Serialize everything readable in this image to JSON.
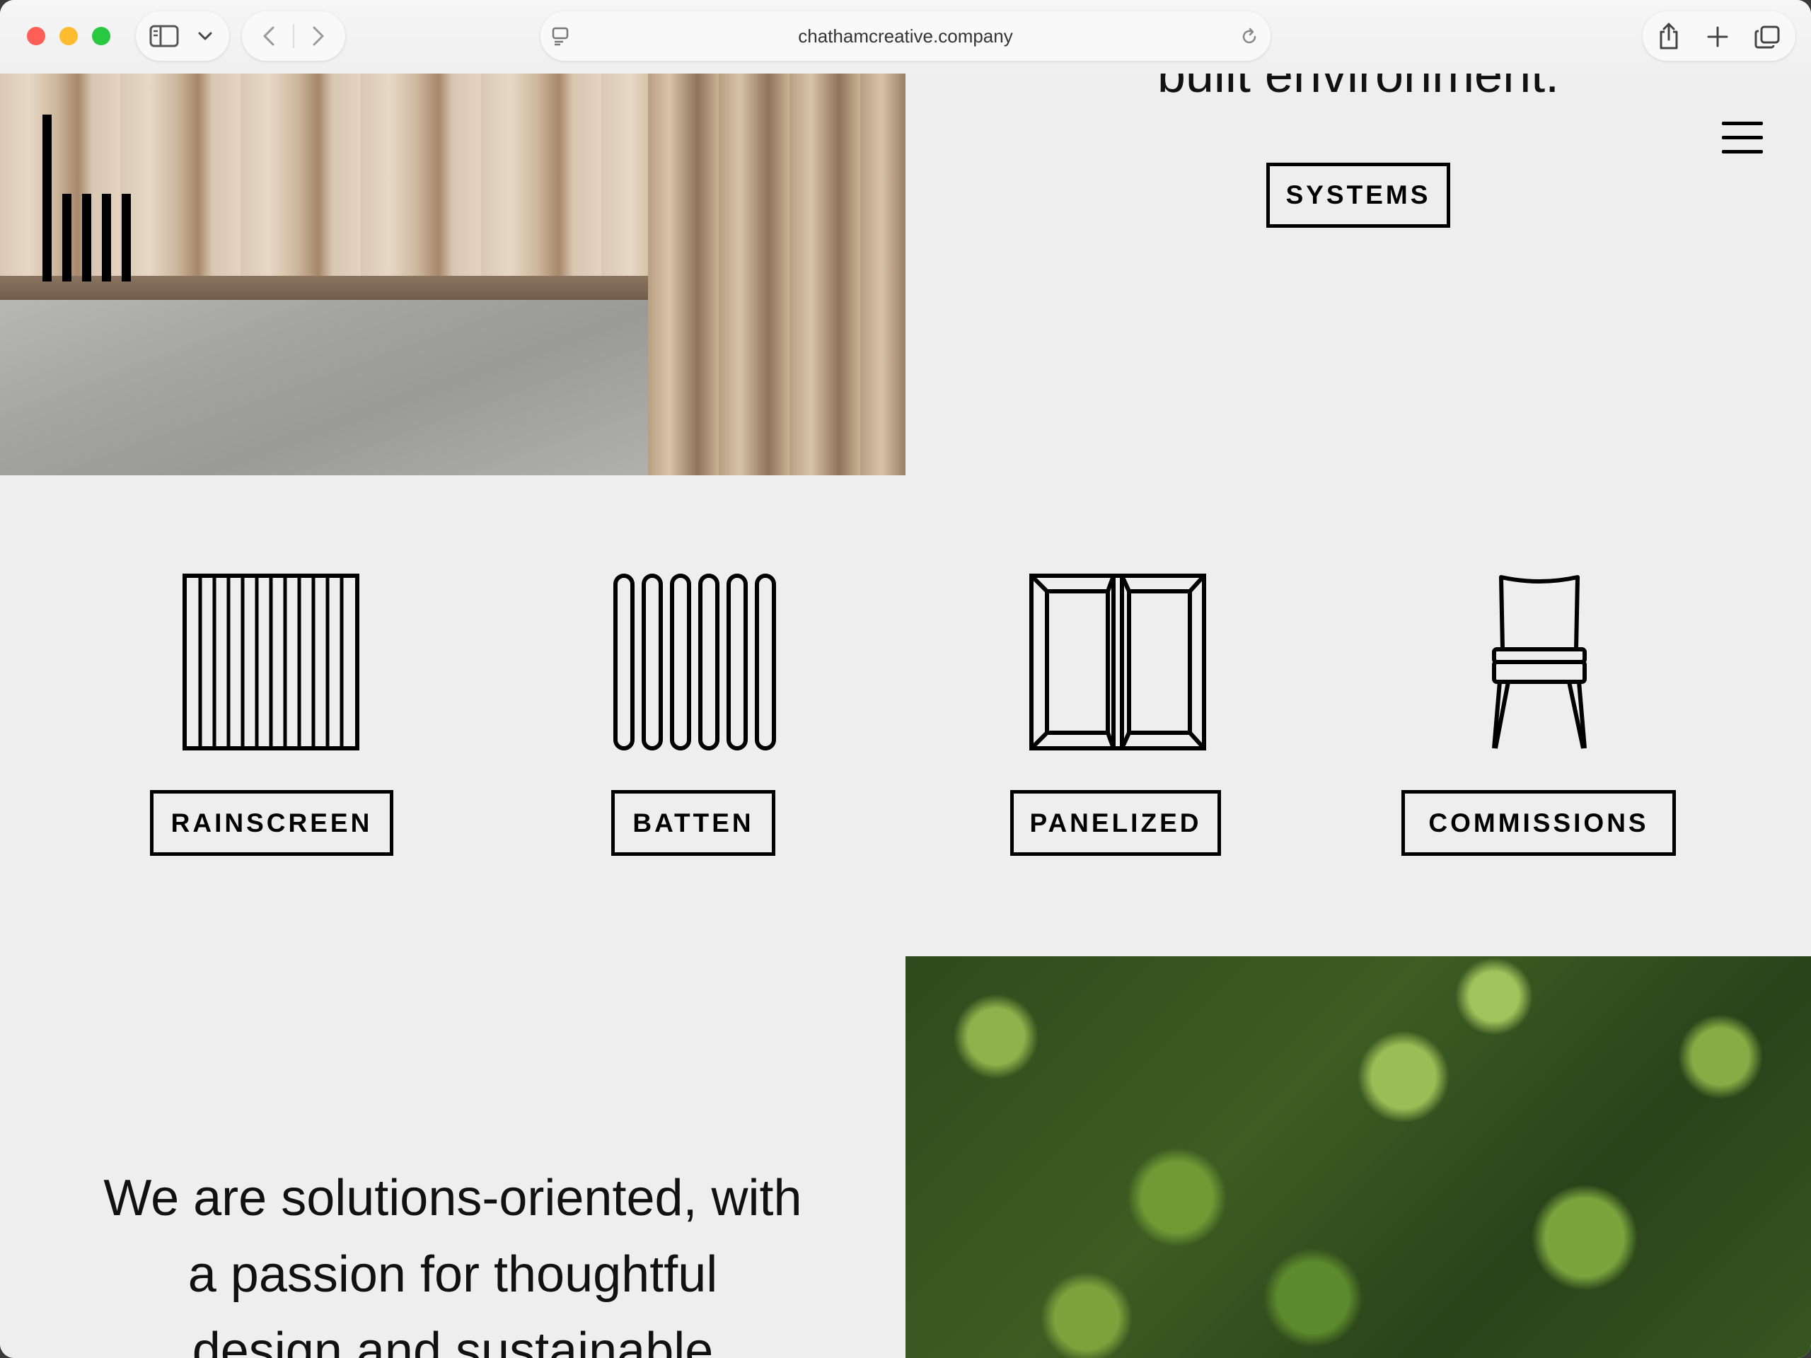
{
  "browser": {
    "url": "chathamcreative.company"
  },
  "hero": {
    "headline": "built environment.",
    "systems_label": "SYSTEMS"
  },
  "systems": [
    {
      "label": "RAINSCREEN",
      "icon": "rainscreen-icon"
    },
    {
      "label": "BATTEN",
      "icon": "batten-icon"
    },
    {
      "label": "PANELIZED",
      "icon": "panelized-icon"
    },
    {
      "label": "COMMISSIONS",
      "icon": "chair-icon"
    }
  ],
  "about": {
    "line1": "We are solutions-oriented, with",
    "line2": "a passion for thoughtful",
    "line3": "design and sustainable"
  },
  "colors": {
    "background": "#eeeeee",
    "text": "#000000",
    "close": "#ff5f57",
    "minimize": "#febc2e",
    "zoom": "#28c840"
  }
}
